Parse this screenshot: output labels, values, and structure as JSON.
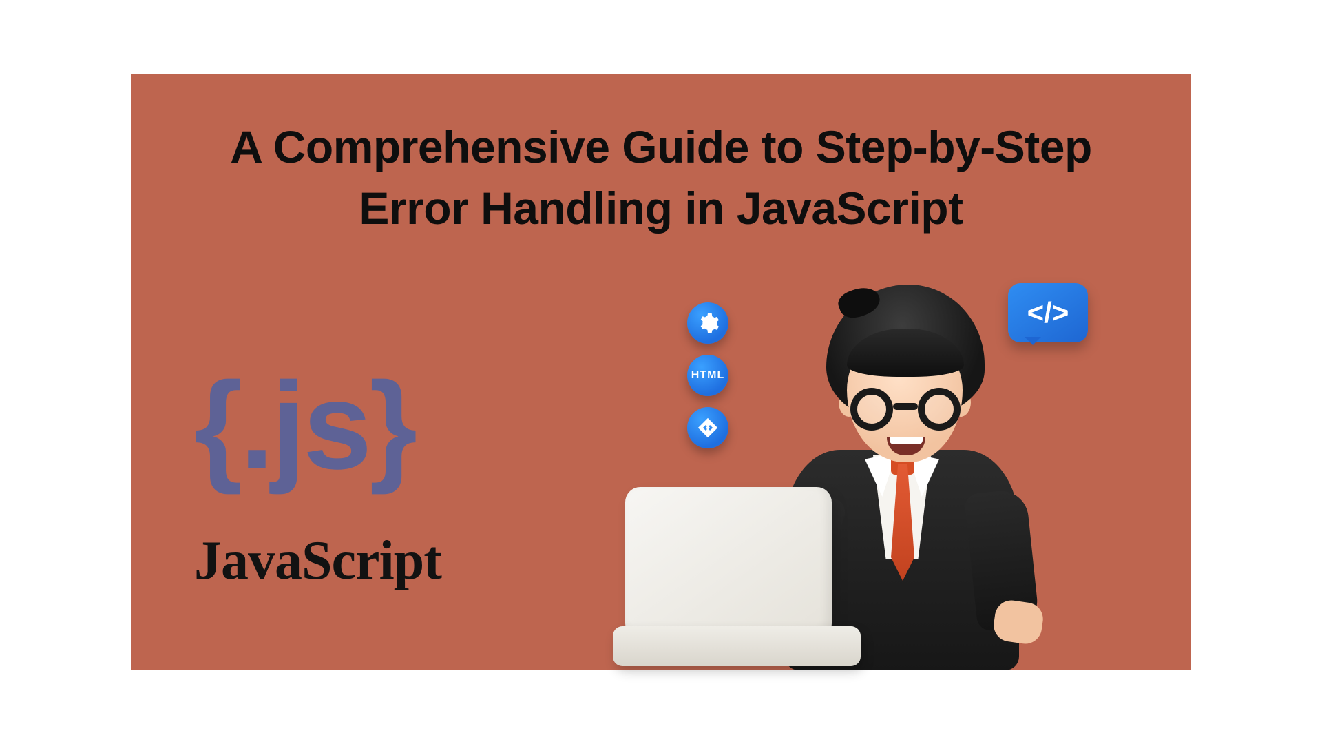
{
  "title": "A Comprehensive Guide to Step-by-Step Error Handling in JavaScript",
  "logo": {
    "symbol": "{.js}",
    "text": "JavaScript"
  },
  "badges": {
    "html": "HTML",
    "diamond": "<>"
  },
  "bubble": "</>"
}
